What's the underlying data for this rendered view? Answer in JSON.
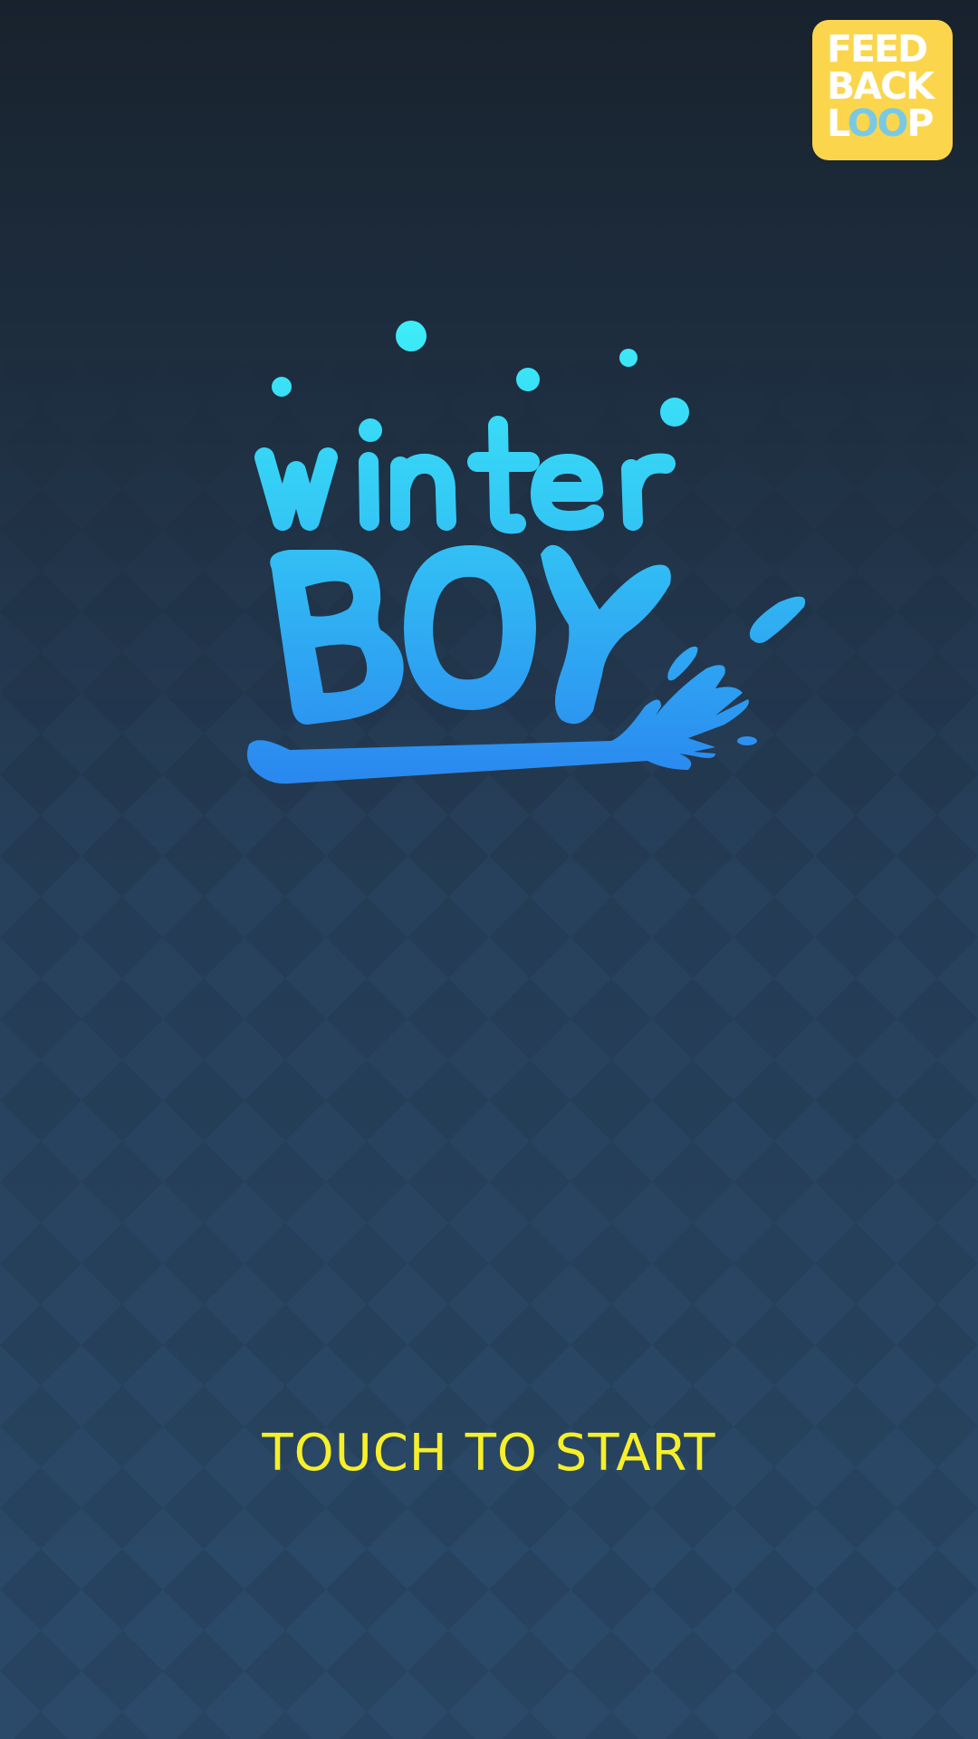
{
  "publisher_badge": {
    "line1": "FEED",
    "line2": "BACK",
    "line3_start": "L",
    "line3_loop": "OO",
    "line3_end": "P",
    "color": "#fbd64d",
    "accent": "#79c9e6"
  },
  "logo": {
    "word1": "winter",
    "word2": "BOY",
    "top_color": "#3ef0f7",
    "bottom_color": "#2a86ef"
  },
  "start_prompt": {
    "label": "TOUCH TO START",
    "color": "#f6ef2a"
  },
  "background": {
    "top_color": "#18222d",
    "bottom_color": "#2b4a6a",
    "pattern": "diamond-checker"
  }
}
